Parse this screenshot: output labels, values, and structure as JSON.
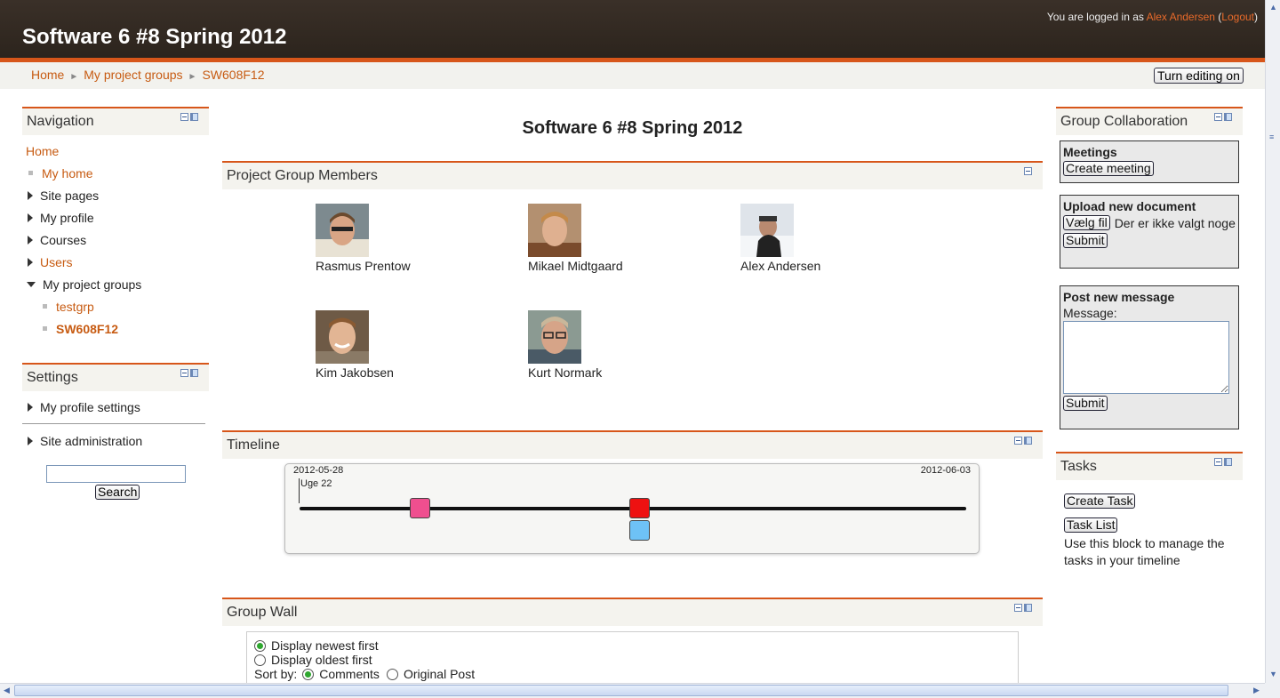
{
  "header": {
    "site_title": "Software 6 #8 Spring 2012",
    "logged_in_prefix": "You are logged in as",
    "user_name": "Alex Andersen",
    "logout_label": "Logout"
  },
  "breadcrumb": [
    "Home",
    "My project groups",
    "SW608F12"
  ],
  "edit_button": "Turn editing on",
  "navigation": {
    "title": "Navigation",
    "items": [
      {
        "label": "Home",
        "kind": "link"
      },
      {
        "label": "My home",
        "kind": "link"
      },
      {
        "label": "Site pages",
        "kind": "expandable"
      },
      {
        "label": "My profile",
        "kind": "expandable"
      },
      {
        "label": "Courses",
        "kind": "expandable"
      },
      {
        "label": "Users",
        "kind": "link"
      },
      {
        "label": "My project groups",
        "kind": "expanded"
      },
      {
        "label": "testgrp",
        "kind": "link"
      },
      {
        "label": "SW608F12",
        "kind": "current"
      }
    ]
  },
  "settings": {
    "title": "Settings",
    "items": [
      "My profile settings",
      "Site administration"
    ],
    "search_button": "Search",
    "search_value": ""
  },
  "main": {
    "page_title": "Software 6 #8 Spring 2012",
    "members_title": "Project Group Members",
    "members": [
      {
        "name": "Rasmus Prentow"
      },
      {
        "name": "Mikael Midtgaard"
      },
      {
        "name": "Alex Andersen"
      },
      {
        "name": "Kim Jakobsen"
      },
      {
        "name": "Kurt Normark"
      }
    ],
    "timeline": {
      "title": "Timeline",
      "start_date": "2012-05-28",
      "end_date": "2012-06-03",
      "week_label": "Uge 22",
      "markers": [
        {
          "position": 0.18,
          "row": 0,
          "color": "#ef4f8f"
        },
        {
          "position": 0.51,
          "row": 0,
          "color": "#ee1111"
        },
        {
          "position": 0.51,
          "row": 1,
          "color": "#6ec2f6"
        }
      ]
    },
    "wall": {
      "title": "Group Wall",
      "option_newest": "Display newest first",
      "option_oldest": "Display oldest first",
      "sort_label": "Sort by:",
      "sort_comments": "Comments",
      "sort_original": "Original Post"
    }
  },
  "collaboration": {
    "title": "Group Collaboration",
    "meetings_title": "Meetings",
    "create_meeting": "Create meeting",
    "upload_title": "Upload new document",
    "choose_file": "Vælg fil",
    "no_file_text": "Der er ikke valgt noge",
    "upload_submit": "Submit",
    "post_title": "Post new message",
    "message_label": "Message:",
    "post_submit": "Submit"
  },
  "tasks": {
    "title": "Tasks",
    "create_task": "Create Task",
    "task_list": "Task List",
    "description": "Use this block to manage the tasks in your timeline"
  },
  "colors": {
    "accent": "#d7561a",
    "link": "#c75b12",
    "header_bg": "#2c241d"
  }
}
